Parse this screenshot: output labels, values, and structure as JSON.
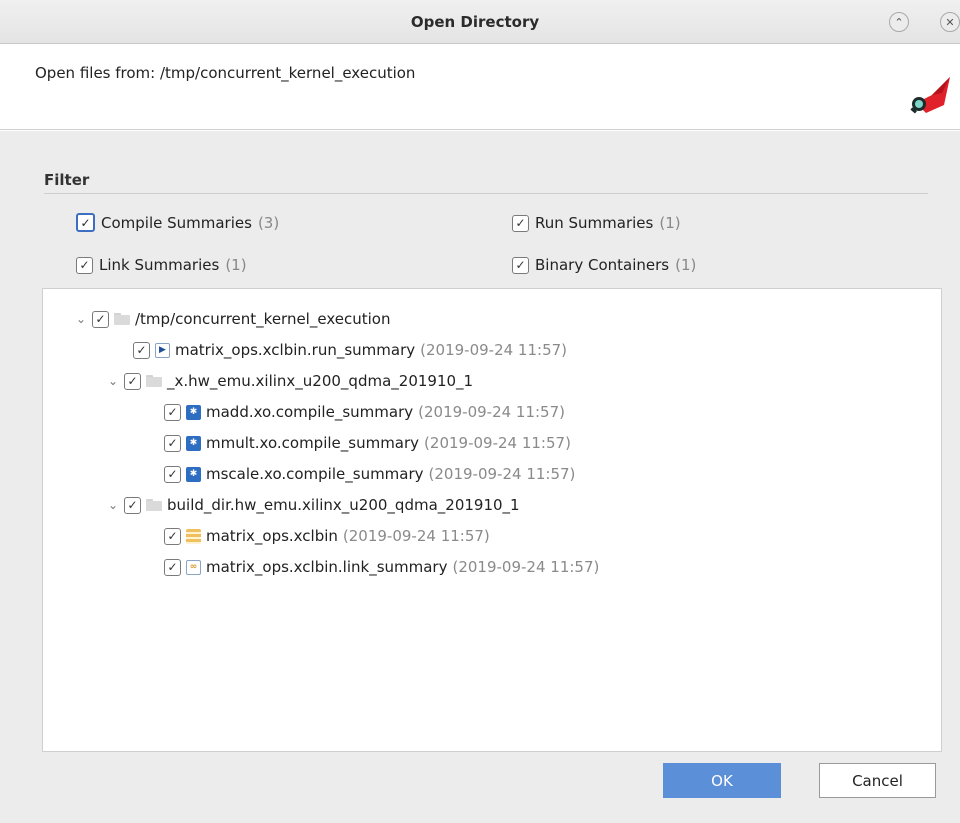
{
  "window": {
    "title": "Open Directory",
    "minimize_glyph": "⌃",
    "close_glyph": "✕"
  },
  "header": {
    "label": "Open files from:  /tmp/concurrent_kernel_execution",
    "logo_icon": "analyzer-logo-icon"
  },
  "filter": {
    "title": "Filter",
    "options": [
      {
        "label": "Compile Summaries",
        "count": "(3)",
        "checked": true
      },
      {
        "label": "Run Summaries",
        "count": "(1)",
        "checked": true
      },
      {
        "label": "Link Summaries",
        "count": "(1)",
        "checked": true
      },
      {
        "label": "Binary Containers",
        "count": "(1)",
        "checked": true
      }
    ]
  },
  "tree": {
    "root": {
      "label": "/tmp/concurrent_kernel_execution",
      "checked": true,
      "expanded": true
    },
    "run_file": {
      "label": "matrix_ops.xclbin.run_summary",
      "time": "(2019-09-24 11:57)"
    },
    "folder1": {
      "label": "_x.hw_emu.xilinx_u200_qdma_201910_1",
      "checked": true,
      "expanded": true
    },
    "folder1_files": [
      {
        "label": "madd.xo.compile_summary",
        "time": "(2019-09-24 11:57)"
      },
      {
        "label": "mmult.xo.compile_summary",
        "time": "(2019-09-24 11:57)"
      },
      {
        "label": "mscale.xo.compile_summary",
        "time": "(2019-09-24 11:57)"
      }
    ],
    "folder2": {
      "label": "build_dir.hw_emu.xilinx_u200_qdma_201910_1",
      "checked": true,
      "expanded": true
    },
    "folder2_files": [
      {
        "label": "matrix_ops.xclbin",
        "time": "(2019-09-24 11:57)"
      },
      {
        "label": "matrix_ops.xclbin.link_summary",
        "time": "(2019-09-24 11:57)"
      }
    ]
  },
  "buttons": {
    "ok": "OK",
    "cancel": "Cancel"
  },
  "glyphs": {
    "check": "✓",
    "chevron_down": "⌄"
  },
  "colors": {
    "ok_button": "#5b8fd8",
    "focus_checkbox": "#3d6ec2",
    "logo_red": "#e0202a"
  }
}
